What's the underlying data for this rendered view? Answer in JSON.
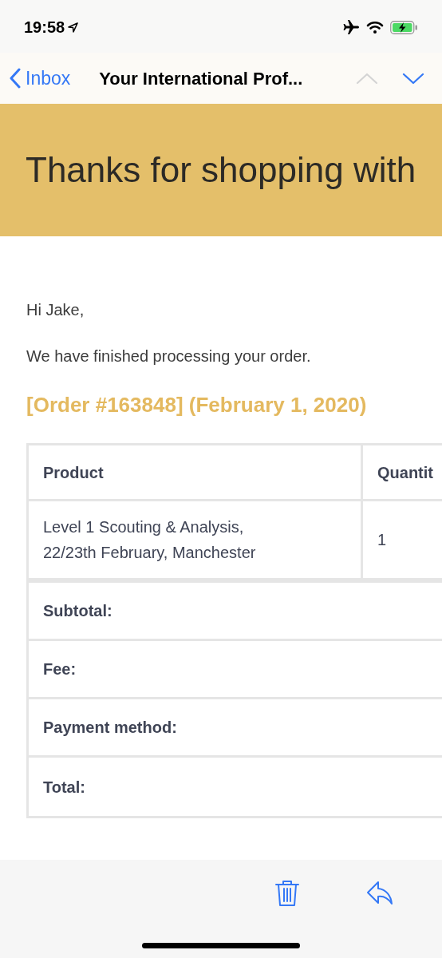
{
  "status_bar": {
    "time": "19:58"
  },
  "nav": {
    "back": "Inbox",
    "title": "Your International Prof...",
    "arrows": [
      {
        "kind": "up",
        "disabled": true
      },
      {
        "kind": "down",
        "disabled": false
      }
    ]
  },
  "banner": {
    "title": "Thanks for shopping with"
  },
  "greeting": "Hi Jake,",
  "message": "We have finished processing your order.",
  "order_heading": "[Order #163848] (February 1, 2020)",
  "table": {
    "columns": [
      "Product",
      "Quantit"
    ],
    "rows": [
      {
        "product": [
          "Level 1 Scouting & Analysis,",
          "22/23th February, Manchester"
        ],
        "quantity": "1"
      }
    ],
    "totals": [
      "Subtotal:",
      "Fee:",
      "Payment method:",
      "Total:"
    ]
  },
  "toolbar": [
    {
      "kind": "trash"
    },
    {
      "kind": "reply"
    }
  ]
}
